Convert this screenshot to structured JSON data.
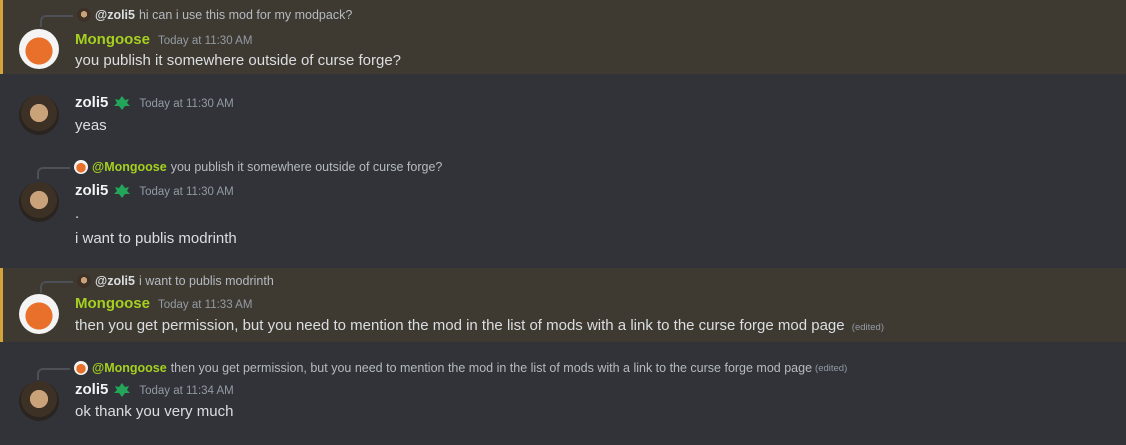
{
  "messages": [
    {
      "reply_name": "@zoli5",
      "reply_text": "hi can i use this mod for my modpack?",
      "author": "Mongoose",
      "timestamp": "Today at 11:30 AM",
      "lines": [
        "you publish it somewhere outside of curse forge?"
      ]
    },
    {
      "author": "zoli5",
      "timestamp": "Today at 11:30 AM",
      "lines": [
        "yeas"
      ],
      "badge": "leaf-badge-icon"
    },
    {
      "reply_name": "@Mongoose",
      "reply_text": "you publish it somewhere outside of curse forge?",
      "author": "zoli5",
      "timestamp": "Today at 11:30 AM",
      "lines": [
        ".",
        "i want to publis modrinth"
      ]
    },
    {
      "reply_name": "@zoli5",
      "reply_text": "i want to publis modrinth",
      "author": "Mongoose",
      "timestamp": "Today at 11:33 AM",
      "lines": [
        "then you get permission, but you need to mention the mod in the list of mods with a link to the curse forge mod page"
      ],
      "edited": "(edited)"
    },
    {
      "reply_name": "@Mongoose",
      "reply_text": "then you get permission, but you need to mention the mod in the list of mods with a link to the curse forge mod page",
      "reply_edited": "(edited)",
      "author": "zoli5",
      "timestamp": "Today at 11:34 AM",
      "lines": [
        "ok thank you very much"
      ]
    }
  ],
  "colors": {
    "background": "#313338",
    "mention_highlight": "#3e3a32",
    "mention_bar": "#d4a33a",
    "mongoose_name": "#a5d01f",
    "badge_green": "#23a55a"
  }
}
